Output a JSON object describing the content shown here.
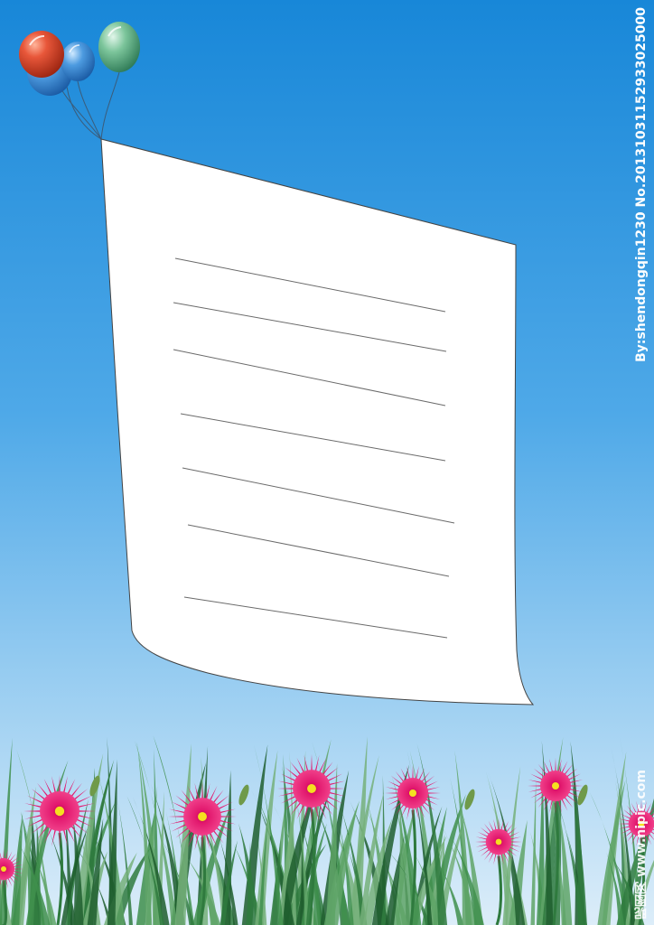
{
  "watermark": {
    "author_line": "By:shendongqin1230  No.20131031152933025000",
    "site_line": "昵图网 www.nipic.com"
  },
  "colors": {
    "sky_top": "#1887d8",
    "sky_mid": "#5eb2ea",
    "sky_bottom": "#cfe8f7",
    "paper": "#ffffff",
    "paper_outline": "#444444",
    "ruled_line": "#6a6a6a",
    "flower_petal": "#e2186e",
    "flower_center": "#f5e020",
    "grass": "#2f7a3e",
    "balloon_red": "#d9452a",
    "balloon_blue": "#3a8fd6",
    "balloon_green": "#6ab58a"
  },
  "icons": [
    "balloon-icon",
    "flower-icon",
    "grass-icon",
    "paper-sheet-icon"
  ]
}
